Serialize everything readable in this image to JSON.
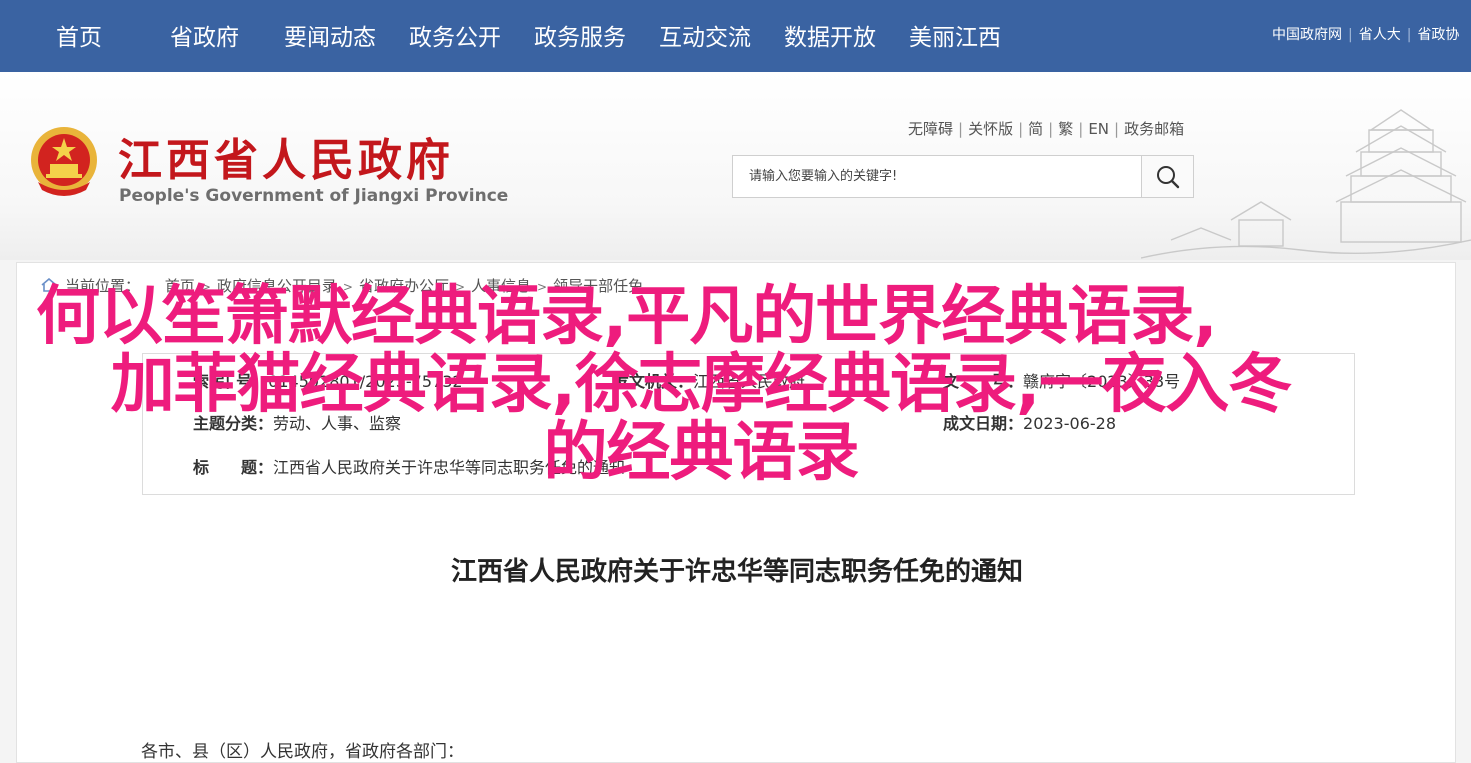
{
  "topnav": {
    "items": [
      "首页",
      "省政府",
      "要闻动态",
      "政务公开",
      "政务服务",
      "互动交流",
      "数据开放",
      "美丽江西"
    ],
    "links": [
      "中国政府网",
      "省人大",
      "省政协"
    ],
    "colors": {
      "bar": "#3a63a2"
    }
  },
  "header": {
    "site_name": "江西省人民政府",
    "site_name_en": "People's Government of Jiangxi Province",
    "util_links": [
      "无障碍",
      "关怀版",
      "简",
      "繁",
      "EN",
      "政务邮箱"
    ],
    "search": {
      "placeholder": "请输入您要输入的关键字!"
    },
    "icons": {
      "emblem": "national-emblem-icon",
      "search": "search-icon",
      "landmark": "pavilion-illustration"
    },
    "colors": {
      "site_name": "#c3171c"
    }
  },
  "breadcrumb": {
    "label": "当前位置：",
    "items": [
      "首页",
      "政府信息公开目录",
      "省政府办公厅",
      "人事信息",
      "领导干部任免"
    ],
    "icon": "home-icon"
  },
  "doc_info": {
    "index_label": "索 引 号：",
    "index_value": "014502801/2023-75732",
    "issuer_label": "发文机关：",
    "issuer_value": "江西省人民政府",
    "topic_label": "主题分类：",
    "topic_value": "劳动、人事、监察",
    "date_label": "成文日期：",
    "date_value": "2023-06-28",
    "docno_label": "文　　号：",
    "docno_value": "赣府字〔2023〕38号",
    "title_label": "标　　题：",
    "title_value": "江西省人民政府关于许忠华等同志职务任免的通知"
  },
  "doc": {
    "title": "江西省人民政府关于许忠华等同志职务任免的通知",
    "salutation": "各市、县（区）人民政府，省政府各部门："
  },
  "overlay": {
    "lines": [
      "何以笙箫默经典语录,平凡的世界经典语录,",
      "加菲猫经典语录,徐志摩经典语录,一夜入冬",
      "的经典语录"
    ],
    "color": "#ee1c7d"
  }
}
